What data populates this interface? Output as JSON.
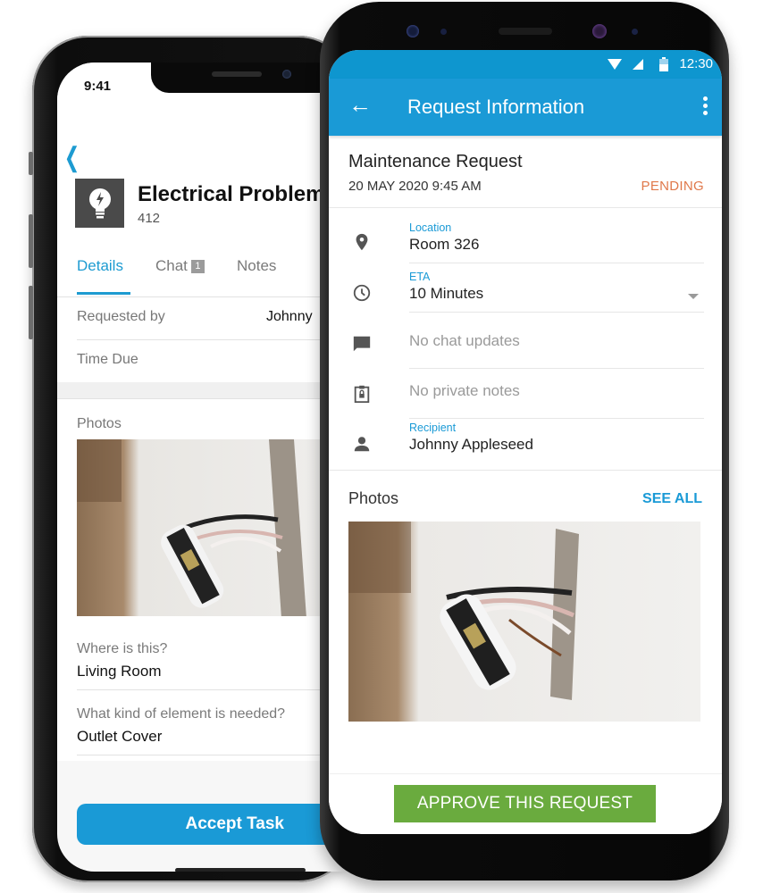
{
  "ios_app": {
    "status_time": "9:41",
    "back_icon": "chevron-left-icon",
    "task_icon": "lightbulb-bolt-icon",
    "task_title": "Electrical Problem",
    "task_number": "412",
    "tabs": [
      {
        "label": "Details",
        "active": true
      },
      {
        "label": "Chat",
        "badge": "1",
        "active": false
      },
      {
        "label": "Notes",
        "active": false
      }
    ],
    "rows": [
      {
        "label": "Requested by",
        "value": "Johnny"
      },
      {
        "label": "Time Due",
        "value": ""
      }
    ],
    "photos_label": "Photos",
    "photo_description": "Outlet pulled out of wall with exposed wires",
    "fields": [
      {
        "question": "Where is this?",
        "answer": "Living Room"
      },
      {
        "question": "What kind of element is needed?",
        "answer": "Outlet Cover"
      }
    ],
    "accept_button": "Accept Task"
  },
  "android_app": {
    "status_time": "12:30",
    "status_icons": [
      "wifi-icon",
      "signal-icon",
      "battery-icon"
    ],
    "appbar": {
      "back_icon": "arrow-left-icon",
      "title": "Request Information",
      "menu_icon": "more-vert-icon"
    },
    "request": {
      "title": "Maintenance Request",
      "date": "20 MAY 2020  9:45 AM",
      "status": "PENDING"
    },
    "details": [
      {
        "icon": "location-pin-icon",
        "caption": "Location",
        "value": "Room 326"
      },
      {
        "icon": "clock-icon",
        "caption": "ETA",
        "value": "10 Minutes",
        "dropdown": true
      },
      {
        "icon": "chat-bubble-icon",
        "caption": "",
        "value": "No chat updates"
      },
      {
        "icon": "clipboard-lock-icon",
        "caption": "",
        "value": "No private notes"
      },
      {
        "icon": "person-icon",
        "caption": "Recipient",
        "value": "Johnny Appleseed"
      }
    ],
    "photos_label": "Photos",
    "see_all": "SEE ALL",
    "approve_button": "APPROVE THIS REQUEST"
  },
  "colors": {
    "accent_blue": "#1a9ad6",
    "pending_orange": "#e0784a",
    "approve_green": "#6aab3e"
  }
}
